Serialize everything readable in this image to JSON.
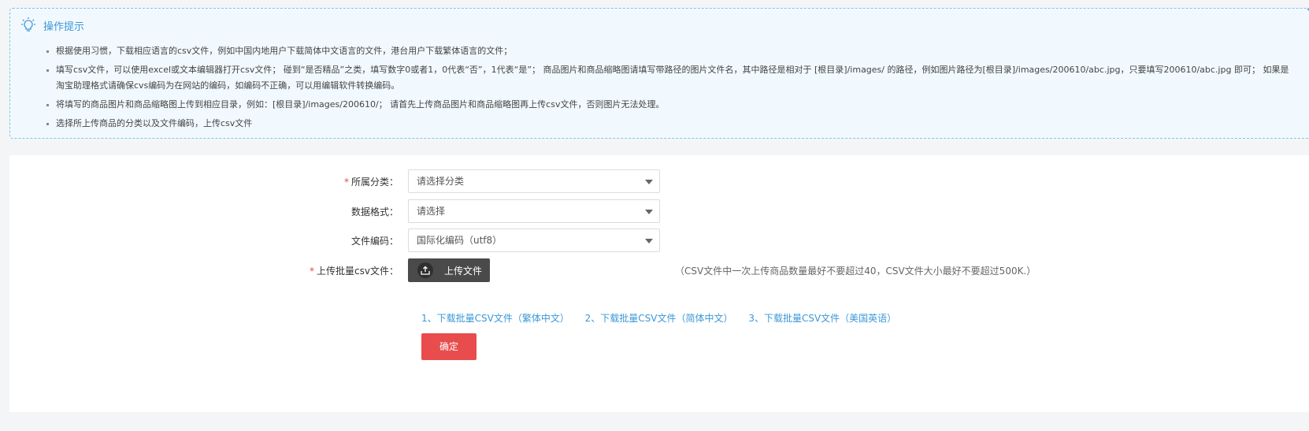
{
  "tips": {
    "title": "操作提示",
    "items": [
      "根据使用习惯，下载相应语言的csv文件，例如中国内地用户下载简体中文语言的文件，港台用户下载繁体语言的文件；",
      "填写csv文件，可以使用excel或文本编辑器打开csv文件； 碰到“是否精品”之类，填写数字0或者1，0代表“否”，1代表“是”； 商品图片和商品缩略图请填写带路径的图片文件名，其中路径是相对于 [根目录]/images/ 的路径，例如图片路径为[根目录]/images/200610/abc.jpg，只要填写200610/abc.jpg 即可； 如果是淘宝助理格式请确保cvs编码为在网站的编码，如编码不正确，可以用编辑软件转换编码。",
      "将填写的商品图片和商品缩略图上传到相应目录，例如：[根目录]/images/200610/； 请首先上传商品图片和商品缩略图再上传csv文件，否则图片无法处理。",
      "选择所上传商品的分类以及文件编码，上传csv文件"
    ]
  },
  "form": {
    "category": {
      "label": "所属分类：",
      "value": "请选择分类",
      "required": "*"
    },
    "format": {
      "label": "数据格式：",
      "value": "请选择"
    },
    "encoding": {
      "label": "文件编码：",
      "value": "国际化编码（utf8）"
    },
    "upload": {
      "label": "上传批量csv文件：",
      "required": "*",
      "button": "上传文件",
      "note": "（CSV文件中一次上传商品数量最好不要超过40，CSV文件大小最好不要超过500K.）"
    },
    "links": [
      "1、下载批量CSV文件（繁体中文）",
      "2、下载批量CSV文件（简体中文）",
      "3、下载批量CSV文件（美国英语）"
    ],
    "submit": "确定"
  }
}
